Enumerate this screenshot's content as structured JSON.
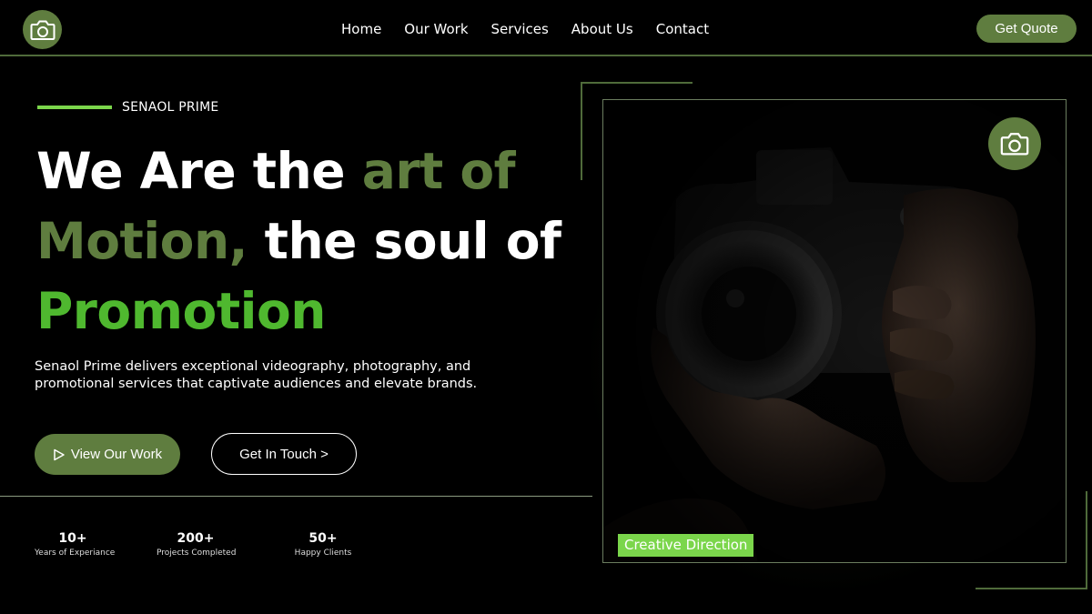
{
  "nav": {
    "logo_icon": "camera-icon",
    "links": [
      "Home",
      "Our Work",
      "Services",
      "About Us",
      "Contact"
    ],
    "cta": "Get Quote"
  },
  "hero": {
    "eyebrow": "SENAOL PRIME",
    "headline": {
      "part1": "We Are the ",
      "part2": "art of",
      "part3": "Motion,",
      "part4": " the soul of",
      "part5": "Promotion"
    },
    "description": "Senaol Prime delivers exceptional videography, photography, and promotional services that captivate audiences and elevate brands.",
    "primary_button": {
      "icon": "play-icon",
      "label": "View Our Work"
    },
    "secondary_button": "Get In Touch >"
  },
  "stats": [
    {
      "value": "10+",
      "label": "Years of Experiance"
    },
    {
      "value": "200+",
      "label": "Projects Completed"
    },
    {
      "value": "50+",
      "label": "Happy Clients"
    }
  ],
  "showcase": {
    "badge_icon": "camera-icon",
    "caption": "Creative Direction"
  },
  "colors": {
    "background": "#000000",
    "olive_accent": "#5f7d3f",
    "lime_accent": "#7bd64b",
    "green_text": "#4fb82f"
  }
}
